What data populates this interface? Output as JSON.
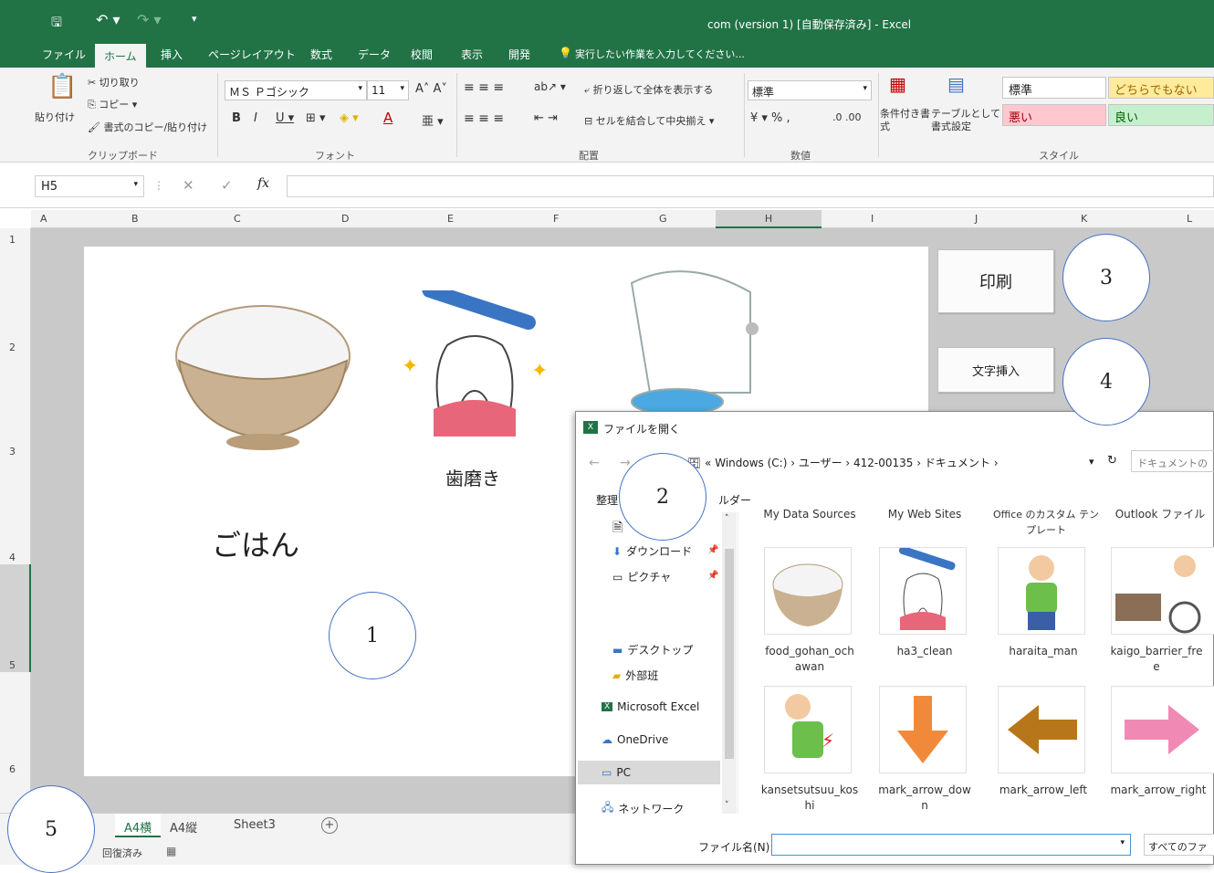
{
  "window": {
    "title": "com (version 1) [自動保存済み] - Excel"
  },
  "menu": {
    "tabs": [
      "ファイル",
      "ホーム",
      "挿入",
      "ページレイアウト",
      "数式",
      "データ",
      "校閲",
      "表示",
      "開発"
    ],
    "tell_me": "実行したい作業を入力してください..."
  },
  "ribbon": {
    "clipboard": {
      "paste": "貼り付け",
      "cut": "切り取り",
      "copy": "コピー",
      "format_painter": "書式のコピー/貼り付け",
      "label": "クリップボード"
    },
    "font": {
      "name": "ＭＳ Ｐゴシック",
      "size": "11",
      "label": "フォント"
    },
    "align": {
      "wrap": "折り返して全体を表示する",
      "merge": "セルを結合して中央揃え",
      "label": "配置"
    },
    "number": {
      "format": "標準",
      "label": "数値"
    },
    "styles": {
      "conditional": "条件付き書式",
      "table": "テーブルとして書式設定",
      "normal": "標準",
      "neutral": "どちらでもない",
      "bad": "悪い",
      "good": "良い",
      "label": "スタイル"
    }
  },
  "formula": {
    "cell_ref": "H5",
    "fx": "fx"
  },
  "columns": [
    "A",
    "B",
    "C",
    "D",
    "E",
    "F",
    "G",
    "H",
    "I",
    "J",
    "K",
    "L"
  ],
  "rows": [
    "1",
    "2",
    "3",
    "4",
    "5",
    "6"
  ],
  "sheet": {
    "labels": {
      "gohan": "ごはん",
      "hamigaki": "歯磨き"
    },
    "buttons": {
      "print": "印刷",
      "insert_text": "文字挿入"
    }
  },
  "callouts": [
    "1",
    "2",
    "3",
    "4",
    "5"
  ],
  "sheet_tabs": [
    "A4横",
    "A4縦",
    "Sheet3"
  ],
  "status": {
    "text": "回復済み"
  },
  "dialog": {
    "title": "ファイルを開く",
    "path": [
      "Windows (C:)",
      "ユーザー",
      "412-00135",
      "ドキュメント"
    ],
    "search_placeholder": "ドキュメントの",
    "organize": "整理",
    "new_folder": "ルダー",
    "header_folders": [
      "My Data Sources",
      "My Web Sites",
      "Office のカスタム テンプレート",
      "Outlook ファイル"
    ],
    "nav": [
      "ダウンロード",
      "ピクチャ",
      "デスクトップ",
      "外部班",
      "Microsoft Excel",
      "OneDrive",
      "PC",
      "ネットワーク"
    ],
    "files": [
      "food_gohan_chawan",
      "ha3_clean",
      "haraita_man",
      "kaigo_barrier_free",
      "kansetsutsuu_koshi",
      "mark_arrow_down",
      "mark_arrow_left",
      "mark_arrow_right"
    ],
    "file_captions": [
      [
        "food_gohan_och",
        "awan"
      ],
      [
        "ha3_clean",
        ""
      ],
      [
        "haraita_man",
        ""
      ],
      [
        "kaigo_barrier_fre",
        "e"
      ],
      [
        "kansetsutsuu_kos",
        "hi"
      ],
      [
        "mark_arrow_dow",
        "n"
      ],
      [
        "mark_arrow_left",
        ""
      ],
      [
        "mark_arrow_right",
        ""
      ]
    ],
    "filename_label": "ファイル名(N):",
    "filetype": "すべてのファ"
  },
  "colors": {
    "excel_green": "#217346",
    "callout_border": "#4472c4"
  }
}
